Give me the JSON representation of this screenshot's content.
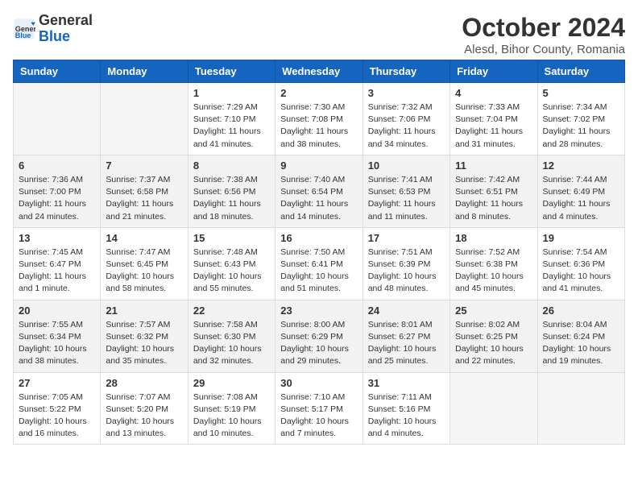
{
  "logo": {
    "text_general": "General",
    "text_blue": "Blue"
  },
  "header": {
    "month": "October 2024",
    "location": "Alesd, Bihor County, Romania"
  },
  "weekdays": [
    "Sunday",
    "Monday",
    "Tuesday",
    "Wednesday",
    "Thursday",
    "Friday",
    "Saturday"
  ],
  "weeks": [
    [
      {
        "day": "",
        "info": ""
      },
      {
        "day": "",
        "info": ""
      },
      {
        "day": "1",
        "info": "Sunrise: 7:29 AM\nSunset: 7:10 PM\nDaylight: 11 hours and 41 minutes."
      },
      {
        "day": "2",
        "info": "Sunrise: 7:30 AM\nSunset: 7:08 PM\nDaylight: 11 hours and 38 minutes."
      },
      {
        "day": "3",
        "info": "Sunrise: 7:32 AM\nSunset: 7:06 PM\nDaylight: 11 hours and 34 minutes."
      },
      {
        "day": "4",
        "info": "Sunrise: 7:33 AM\nSunset: 7:04 PM\nDaylight: 11 hours and 31 minutes."
      },
      {
        "day": "5",
        "info": "Sunrise: 7:34 AM\nSunset: 7:02 PM\nDaylight: 11 hours and 28 minutes."
      }
    ],
    [
      {
        "day": "6",
        "info": "Sunrise: 7:36 AM\nSunset: 7:00 PM\nDaylight: 11 hours and 24 minutes."
      },
      {
        "day": "7",
        "info": "Sunrise: 7:37 AM\nSunset: 6:58 PM\nDaylight: 11 hours and 21 minutes."
      },
      {
        "day": "8",
        "info": "Sunrise: 7:38 AM\nSunset: 6:56 PM\nDaylight: 11 hours and 18 minutes."
      },
      {
        "day": "9",
        "info": "Sunrise: 7:40 AM\nSunset: 6:54 PM\nDaylight: 11 hours and 14 minutes."
      },
      {
        "day": "10",
        "info": "Sunrise: 7:41 AM\nSunset: 6:53 PM\nDaylight: 11 hours and 11 minutes."
      },
      {
        "day": "11",
        "info": "Sunrise: 7:42 AM\nSunset: 6:51 PM\nDaylight: 11 hours and 8 minutes."
      },
      {
        "day": "12",
        "info": "Sunrise: 7:44 AM\nSunset: 6:49 PM\nDaylight: 11 hours and 4 minutes."
      }
    ],
    [
      {
        "day": "13",
        "info": "Sunrise: 7:45 AM\nSunset: 6:47 PM\nDaylight: 11 hours and 1 minute."
      },
      {
        "day": "14",
        "info": "Sunrise: 7:47 AM\nSunset: 6:45 PM\nDaylight: 10 hours and 58 minutes."
      },
      {
        "day": "15",
        "info": "Sunrise: 7:48 AM\nSunset: 6:43 PM\nDaylight: 10 hours and 55 minutes."
      },
      {
        "day": "16",
        "info": "Sunrise: 7:50 AM\nSunset: 6:41 PM\nDaylight: 10 hours and 51 minutes."
      },
      {
        "day": "17",
        "info": "Sunrise: 7:51 AM\nSunset: 6:39 PM\nDaylight: 10 hours and 48 minutes."
      },
      {
        "day": "18",
        "info": "Sunrise: 7:52 AM\nSunset: 6:38 PM\nDaylight: 10 hours and 45 minutes."
      },
      {
        "day": "19",
        "info": "Sunrise: 7:54 AM\nSunset: 6:36 PM\nDaylight: 10 hours and 41 minutes."
      }
    ],
    [
      {
        "day": "20",
        "info": "Sunrise: 7:55 AM\nSunset: 6:34 PM\nDaylight: 10 hours and 38 minutes."
      },
      {
        "day": "21",
        "info": "Sunrise: 7:57 AM\nSunset: 6:32 PM\nDaylight: 10 hours and 35 minutes."
      },
      {
        "day": "22",
        "info": "Sunrise: 7:58 AM\nSunset: 6:30 PM\nDaylight: 10 hours and 32 minutes."
      },
      {
        "day": "23",
        "info": "Sunrise: 8:00 AM\nSunset: 6:29 PM\nDaylight: 10 hours and 29 minutes."
      },
      {
        "day": "24",
        "info": "Sunrise: 8:01 AM\nSunset: 6:27 PM\nDaylight: 10 hours and 25 minutes."
      },
      {
        "day": "25",
        "info": "Sunrise: 8:02 AM\nSunset: 6:25 PM\nDaylight: 10 hours and 22 minutes."
      },
      {
        "day": "26",
        "info": "Sunrise: 8:04 AM\nSunset: 6:24 PM\nDaylight: 10 hours and 19 minutes."
      }
    ],
    [
      {
        "day": "27",
        "info": "Sunrise: 7:05 AM\nSunset: 5:22 PM\nDaylight: 10 hours and 16 minutes."
      },
      {
        "day": "28",
        "info": "Sunrise: 7:07 AM\nSunset: 5:20 PM\nDaylight: 10 hours and 13 minutes."
      },
      {
        "day": "29",
        "info": "Sunrise: 7:08 AM\nSunset: 5:19 PM\nDaylight: 10 hours and 10 minutes."
      },
      {
        "day": "30",
        "info": "Sunrise: 7:10 AM\nSunset: 5:17 PM\nDaylight: 10 hours and 7 minutes."
      },
      {
        "day": "31",
        "info": "Sunrise: 7:11 AM\nSunset: 5:16 PM\nDaylight: 10 hours and 4 minutes."
      },
      {
        "day": "",
        "info": ""
      },
      {
        "day": "",
        "info": ""
      }
    ]
  ]
}
